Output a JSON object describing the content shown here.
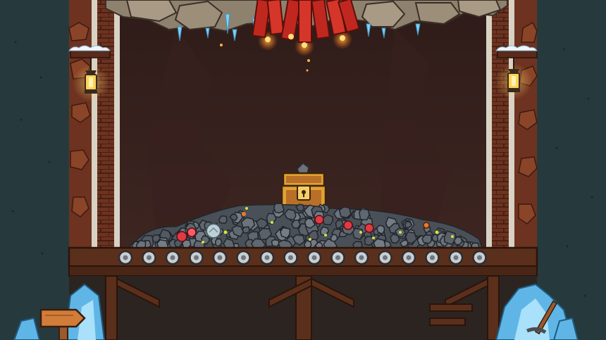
{
  "scene": {
    "type": "mine-shaft-game-scene",
    "palette": {
      "outer_wall": "#26383b",
      "shaft_back": "#3a2320",
      "brick": "#7a3a22",
      "rock_ceiling": "#9c8e79",
      "dynamite": "#c0281f",
      "chest_gold": "#e2a231",
      "ore_gray": "#5f6770",
      "gem_red": "#e03a44",
      "gem_yellow": "#d9e23a",
      "ice_crystal": "#5fb6e6",
      "conveyor_metal": "#c9ced2"
    },
    "icons": [
      "dynamite-bundle-icon",
      "treasure-chest-icon",
      "lantern-icon",
      "ice-crystal-icon",
      "wooden-signpost-icon",
      "pickaxe-icon"
    ]
  }
}
